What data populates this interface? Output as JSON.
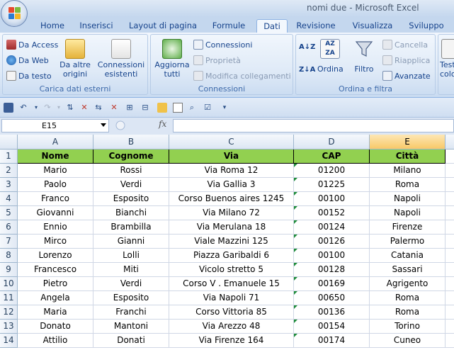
{
  "window": {
    "title": "nomi due - Microsoft Excel"
  },
  "tabs": [
    "Home",
    "Inserisci",
    "Layout di pagina",
    "Formule",
    "Dati",
    "Revisione",
    "Visualizza",
    "Sviluppo"
  ],
  "active_tab": "Dati",
  "ribbon": {
    "group_external": {
      "label": "Carica dati esterni",
      "access": "Da Access",
      "web": "Da Web",
      "text": "Da testo",
      "other_line1": "Da altre",
      "other_line2": "origini",
      "existing_line1": "Connessioni",
      "existing_line2": "esistenti"
    },
    "group_connections": {
      "label": "Connessioni",
      "refresh_line1": "Aggiorna",
      "refresh_line2": "tutti",
      "connections": "Connessioni",
      "properties": "Proprietà",
      "edit_links": "Modifica collegamenti"
    },
    "group_sort": {
      "label": "Ordina e filtra",
      "sort": "Ordina",
      "filter": "Filtro",
      "clear": "Cancella",
      "reapply": "Riapplica",
      "advanced": "Avanzate"
    },
    "group_tools": {
      "line1": "Testo",
      "line2": "colo"
    }
  },
  "formula_bar": {
    "name_box": "E15",
    "fx": "fx",
    "formula": ""
  },
  "sheet": {
    "columns": [
      "A",
      "B",
      "C",
      "D",
      "E"
    ],
    "selected_column": "E",
    "row_numbers": [
      "1",
      "2",
      "3",
      "4",
      "5",
      "6",
      "7",
      "8",
      "9",
      "10",
      "11",
      "12",
      "13",
      "14"
    ],
    "header": [
      "Nome",
      "Cognome",
      "Via",
      "CAP",
      "Città"
    ],
    "rows": [
      [
        "Mario",
        "Rossi",
        "Via Roma 12",
        "01200",
        "Milano"
      ],
      [
        "Paolo",
        "Verdi",
        "Via Gallia 3",
        "01225",
        "Roma"
      ],
      [
        "Franco",
        "Esposito",
        "Corso Buenos aires 1245",
        "00100",
        "Napoli"
      ],
      [
        "Giovanni",
        "Bianchi",
        "Via Milano 72",
        "00152",
        "Napoli"
      ],
      [
        "Ennio",
        "Brambilla",
        "Via Merulana 18",
        "00124",
        "Firenze"
      ],
      [
        "Mirco",
        "Gianni",
        "Viale Mazzini 125",
        "00126",
        "Palermo"
      ],
      [
        "Lorenzo",
        "Lolli",
        "Piazza Garibaldi 6",
        "00100",
        "Catania"
      ],
      [
        "Francesco",
        "Miti",
        "Vicolo stretto 5",
        "00128",
        "Sassari"
      ],
      [
        "Pietro",
        "Verdi",
        "Corso V . Emanuele 15",
        "00169",
        "Agrigento"
      ],
      [
        "Angela",
        "Esposito",
        "Via Napoli 71",
        "00650",
        "Roma"
      ],
      [
        "Maria",
        "Franchi",
        "Corso Vittoria 85",
        "00136",
        "Roma"
      ],
      [
        "Donato",
        "Mantoni",
        "Via Arezzo 48",
        "00154",
        "Torino"
      ],
      [
        "Attilio",
        "Donati",
        "Via Firenze 164",
        "00174",
        "Cuneo"
      ]
    ]
  }
}
